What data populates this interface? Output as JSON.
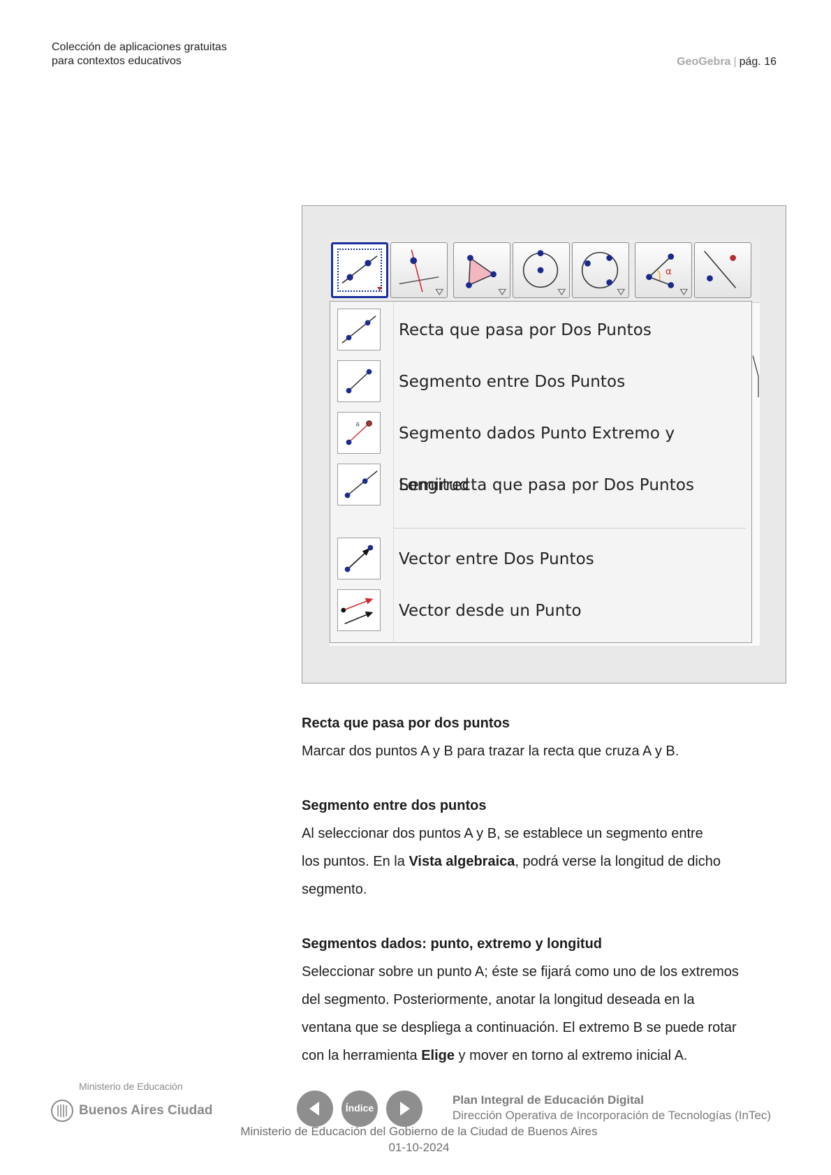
{
  "header": {
    "collection_line1": "Colección de aplicaciones gratuitas",
    "collection_line2": "para contextos educativos",
    "app_name": "GeoGebra",
    "separator": "|",
    "page": "pág. 16"
  },
  "tool_menu": {
    "toolbar_icons": [
      "line-through-two-points-icon",
      "perpendicular-line-icon",
      "polygon-icon",
      "circle-center-point-icon",
      "circle-three-points-icon",
      "angle-icon",
      "reflect-icon"
    ],
    "items": [
      {
        "label": "Recta que pasa por Dos Puntos",
        "icon": "line-icon"
      },
      {
        "label": "Segmento entre Dos Puntos",
        "icon": "segment-icon"
      },
      {
        "label": "Segmento dados Punto Extremo y Longitud",
        "icon": "segment-fixed-length-icon"
      },
      {
        "label": "Semirrecta que pasa por Dos Puntos",
        "icon": "ray-icon"
      },
      {
        "label": "Vector entre Dos Puntos",
        "icon": "vector-icon"
      },
      {
        "label": "Vector desde un Punto",
        "icon": "vector-from-point-icon"
      }
    ]
  },
  "sections": {
    "recta": {
      "title": "Recta que pasa por dos puntos",
      "text": "Marcar dos puntos A y B para trazar la recta que cruza A y B."
    },
    "segmento": {
      "title": "Segmento entre dos puntos",
      "line1": "Al seleccionar dos puntos A y B, se establece un segmento entre",
      "line2_a": "los puntos. En la ",
      "line2_bold": "Vista algebraica",
      "line2_b": ", podrá verse la longitud de dicho",
      "line3": "segmento."
    },
    "segmentos_dados": {
      "title": "Segmentos dados: punto, extremo y longitud",
      "line1": "Seleccionar sobre un punto A; éste se fijará como uno de los extremos",
      "line2": "del segmento. Posteriormente, anotar la longitud deseada en la",
      "line3": "ventana que se despliega a continuación. El extremo B se puede rotar",
      "line4_a": "con la herramienta ",
      "line4_bold": "Elige",
      "line4_b": " y mover en torno al extremo inicial A."
    }
  },
  "footer": {
    "ministry": "Ministerio de Educación",
    "city": "Buenos Aires Ciudad",
    "index_label": "Índice",
    "plan": "Plan Integral de Educación Digital",
    "direccion": "Dirección Operativa de Incorporación de Tecnologías (InTec)",
    "government": "Ministerio de Educación del Gobierno de la Ciudad de Buenos Aires",
    "date": "01-10-2024"
  }
}
